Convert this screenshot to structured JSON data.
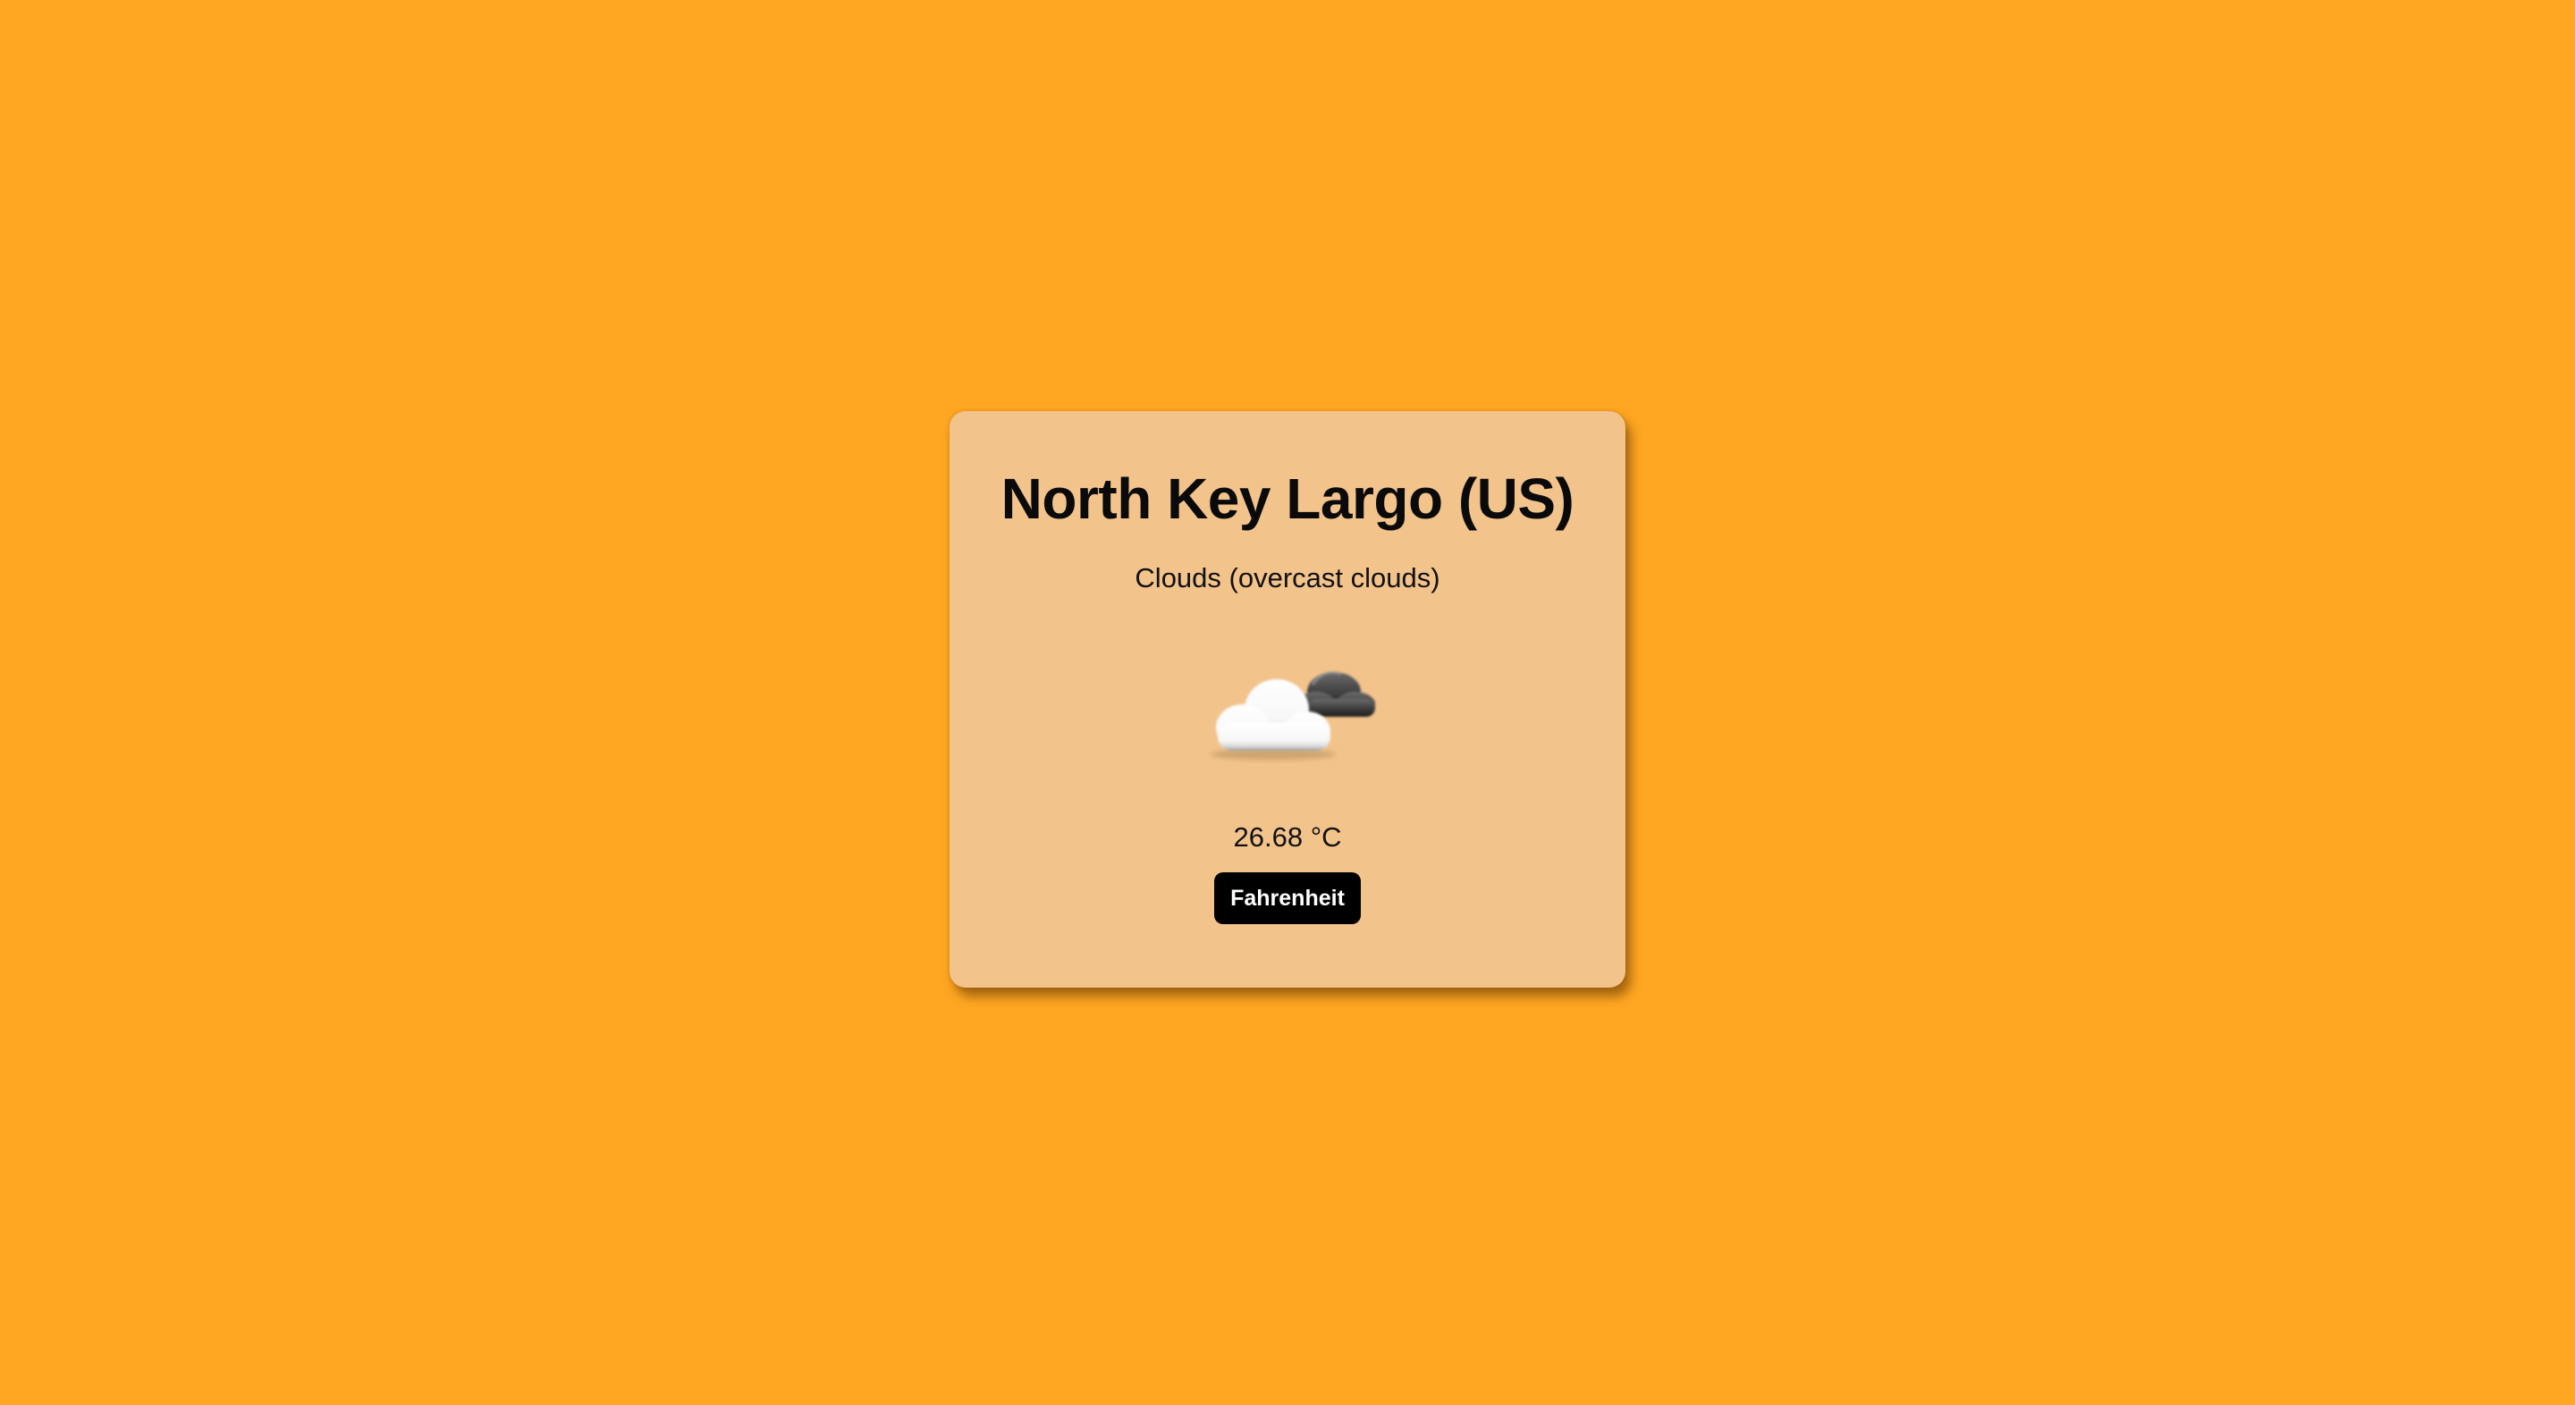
{
  "location": {
    "title": "North Key Largo (US)"
  },
  "weather": {
    "description": "Clouds (overcast clouds)",
    "icon": "overcast-clouds-icon",
    "temperature": "26.68 °C"
  },
  "controls": {
    "unit_toggle_label": "Fahrenheit"
  },
  "colors": {
    "background": "#FFA722",
    "card": "#F2C38B",
    "button": "#000000",
    "button_text": "#FFFFFF"
  }
}
